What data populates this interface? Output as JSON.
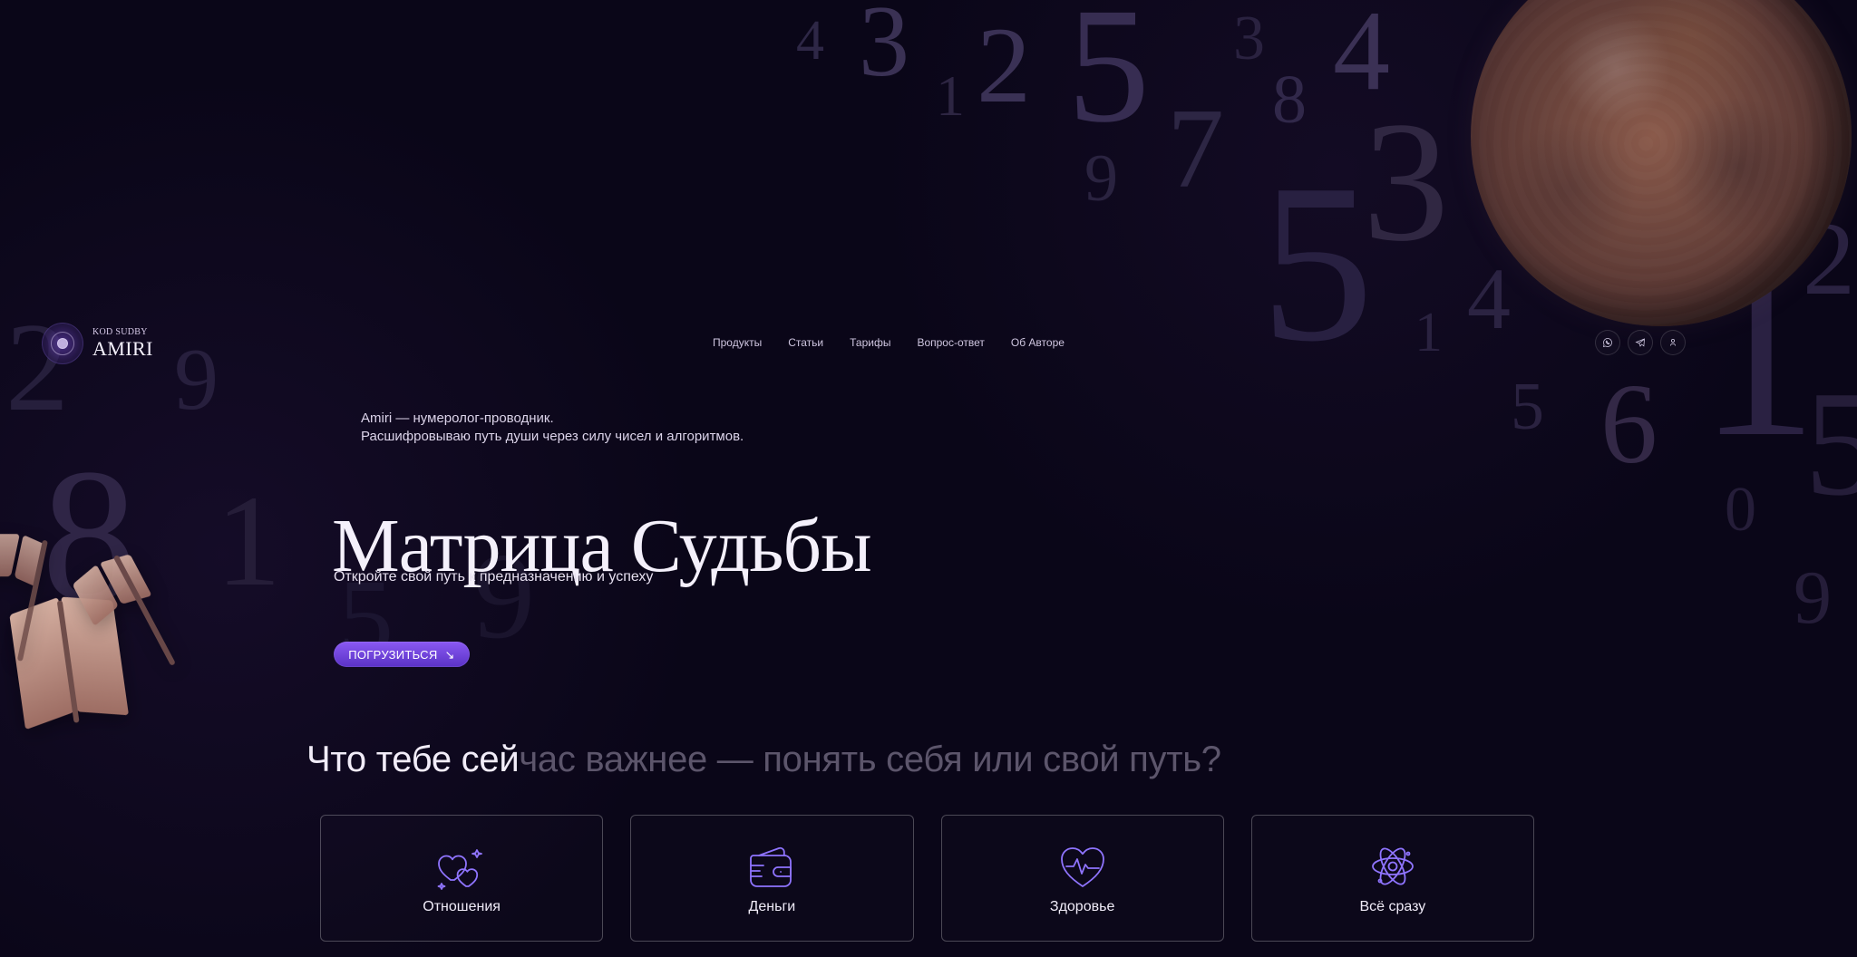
{
  "brand": {
    "small": "KOD SUDBY",
    "name": "AMIRI"
  },
  "nav": {
    "items": [
      {
        "label": "Продукты"
      },
      {
        "label": "Статьи"
      },
      {
        "label": "Тарифы"
      },
      {
        "label": "Вопрос-ответ"
      },
      {
        "label": "Об Авторе"
      }
    ]
  },
  "header_icons": {
    "items": [
      {
        "name": "whatsapp-icon",
        "label": ""
      },
      {
        "name": "telegram-icon",
        "label": ""
      },
      {
        "name": "user-icon",
        "label": ""
      }
    ]
  },
  "hero": {
    "intro_brand": "Amiri",
    "intro_dash": "—",
    "intro_role": "нумеролог-проводник.",
    "intro_line2": "Расшифровываю путь души через силу чисел и алгоритмов.",
    "title": "Матрица Судьбы",
    "subtitle": "Откройте свой путь к предназначению и успеху",
    "cta": "ПОГРУЗИТЬСЯ"
  },
  "section": {
    "question_lit": "Что тебе сей",
    "question_dim": "час важнее — понять себя или свой путь?"
  },
  "cards": [
    {
      "label": "Отношения",
      "icon": "hearts-icon"
    },
    {
      "label": "Деньги",
      "icon": "wallet-icon"
    },
    {
      "label": "Здоровье",
      "icon": "heartbeat-icon"
    },
    {
      "label": "Всё сразу",
      "icon": "atom-icon"
    }
  ],
  "colors": {
    "background": "#0a0618",
    "accent": "#7b4ce0",
    "text": "#f4f0fb",
    "muted_text": "#5c556b",
    "card_border": "#ffffff42"
  }
}
